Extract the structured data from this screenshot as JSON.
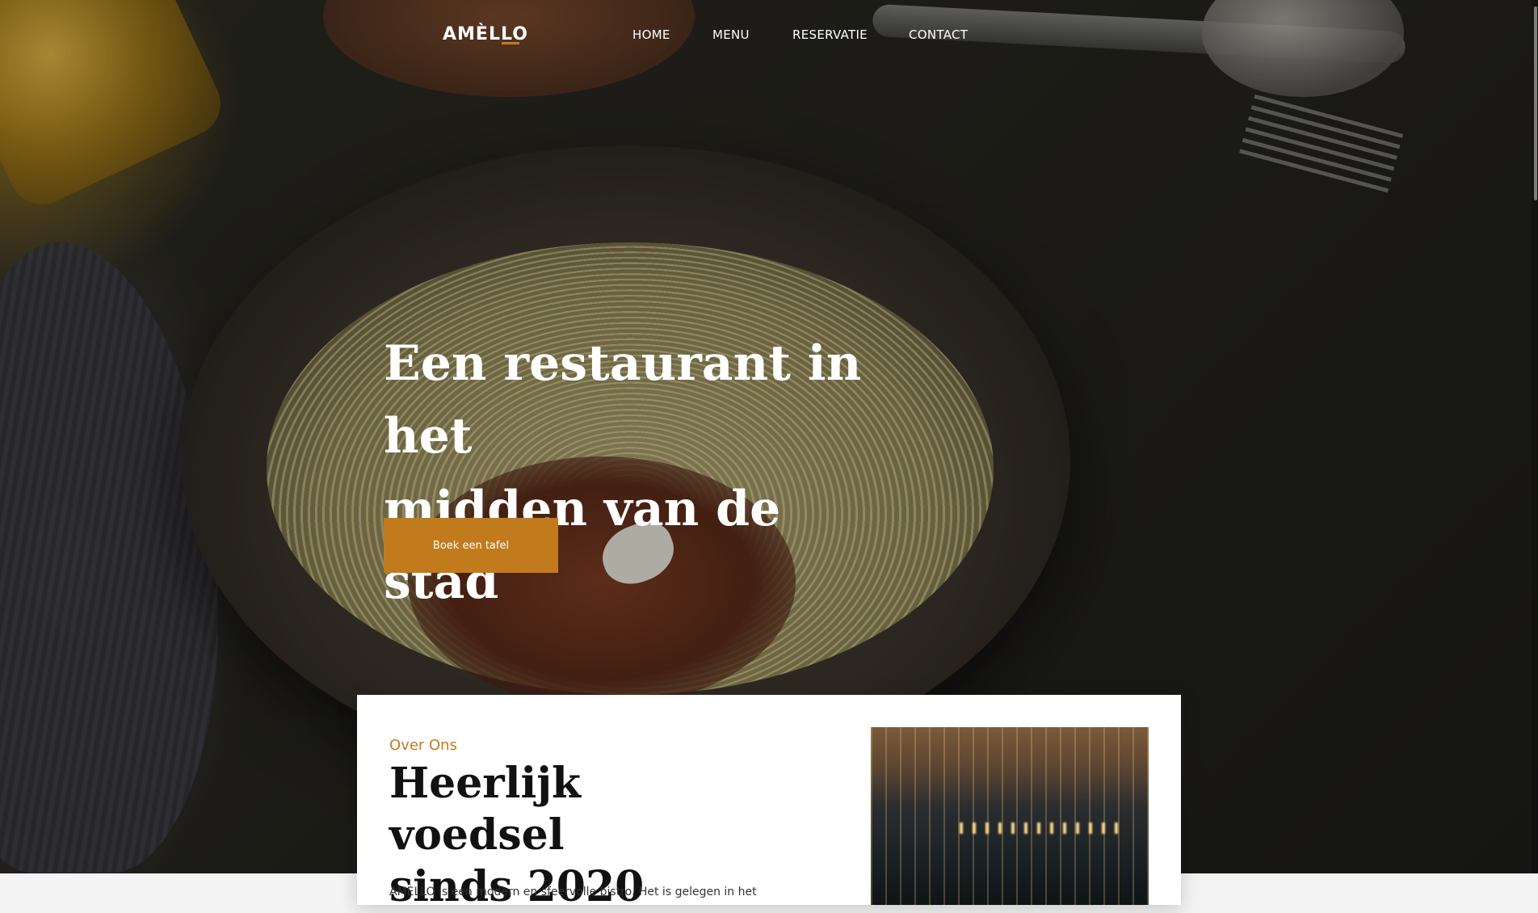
{
  "site": {
    "logo_text": "AMÈLLO"
  },
  "nav": {
    "items": [
      "HOME",
      "MENU",
      "RESERVATIE",
      "CONTACT"
    ]
  },
  "hero": {
    "title_line1": "Een restaurant in het",
    "title_line2": "midden van de stad",
    "cta_label": "Boek een tafel"
  },
  "about": {
    "kicker": "Over Ons",
    "title_line1": "Heerlijk voedsel",
    "title_line2": "sinds 2020",
    "text": "AMÈLLO is een modern en sfeervolle bistro. Het is gelegen in het"
  },
  "colors": {
    "accent": "#c17b1d",
    "nav_text": "#ffffff"
  },
  "icons": {
    "hero_image": "pasta-plate-photo",
    "about_image": "restaurant-interior-photo"
  }
}
